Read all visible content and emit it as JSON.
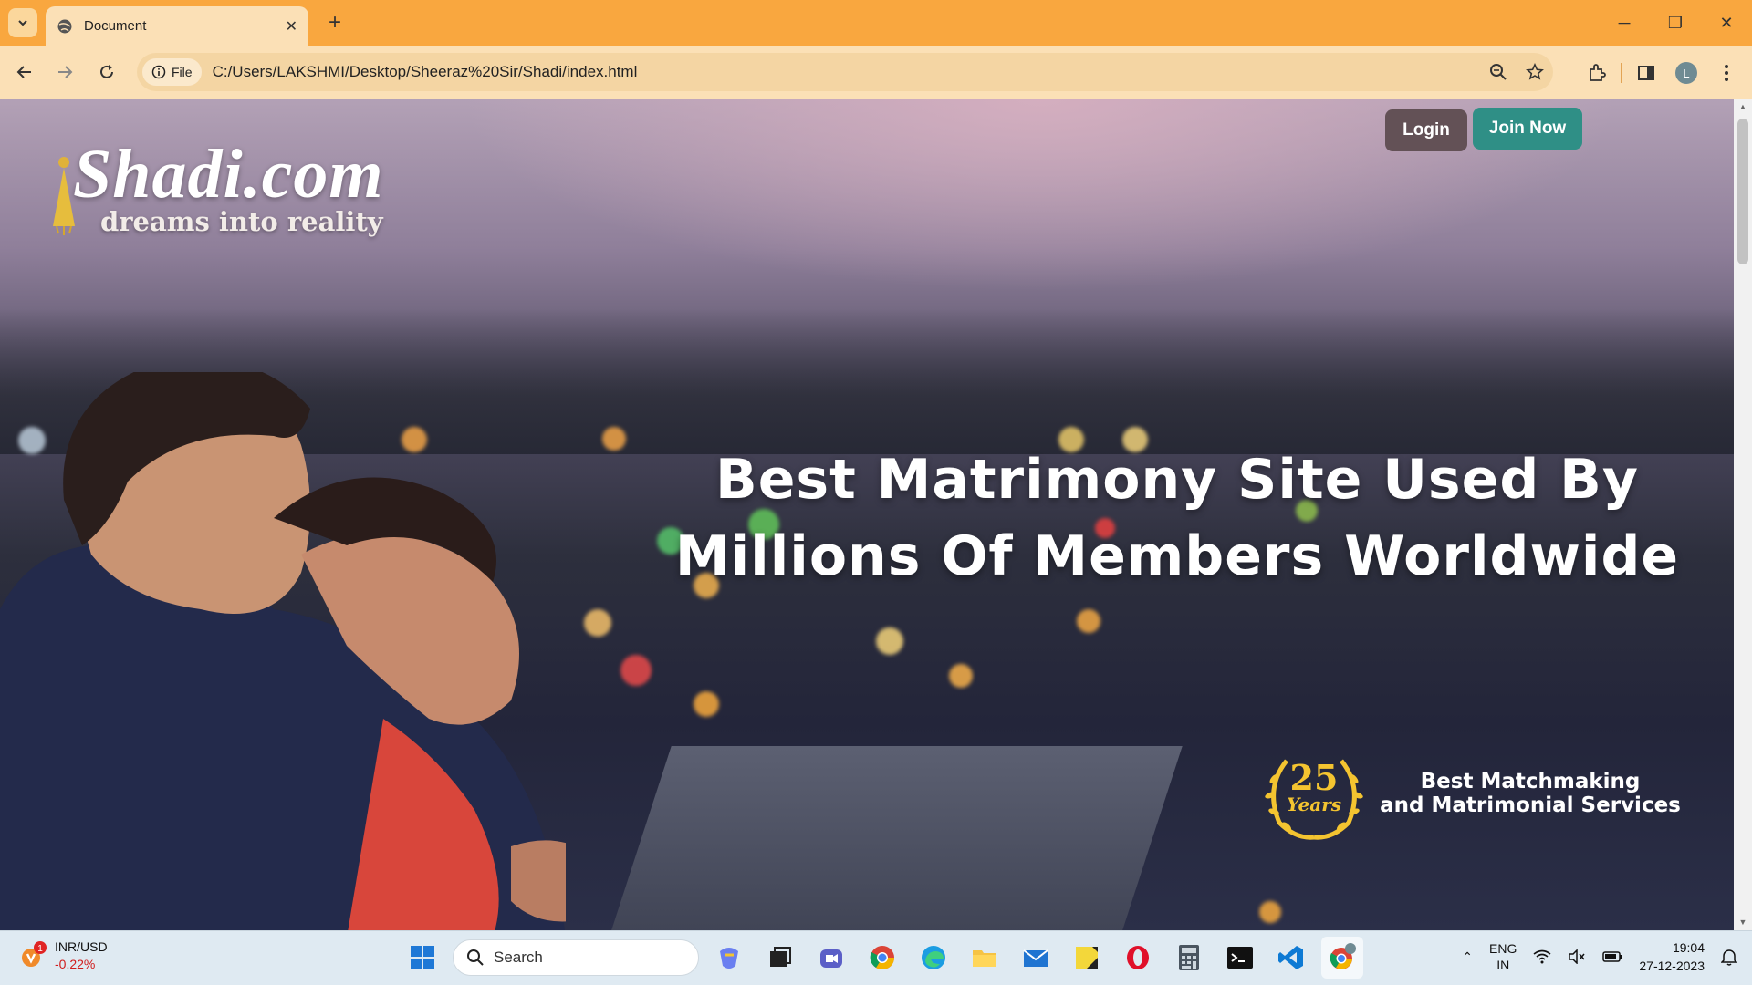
{
  "browser": {
    "tab_title": "Document",
    "url": "C:/Users/LAKSHMI/Desktop/Sheeraz%20Sir/Shadi/index.html",
    "site_chip_label": "File",
    "profile_initial": "L"
  },
  "page": {
    "logo_main": "Shadi.com",
    "logo_sub": "dreams into reality",
    "login_label": "Login",
    "join_label": "Join Now",
    "headline_line1": "Best Matrimony Site Used By",
    "headline_line2": "Millions Of Members Worldwide",
    "badge_number": "25",
    "badge_years": "Years",
    "badge_text_line1": "Best Matchmaking",
    "badge_text_line2": "and Matrimonial Services"
  },
  "taskbar": {
    "ticker_name": "INR/USD",
    "ticker_change": "-0.22%",
    "ticker_alert_count": "1",
    "search_placeholder": "Search",
    "lang_line1": "ENG",
    "lang_line2": "IN",
    "time": "19:04",
    "date": "27-12-2023"
  },
  "colors": {
    "tabbar": "#f9a73f",
    "toolbar": "#fbe0b6",
    "login_bg": "#635156",
    "join_bg": "#2f8f86",
    "badge_gold": "#f4c430"
  }
}
